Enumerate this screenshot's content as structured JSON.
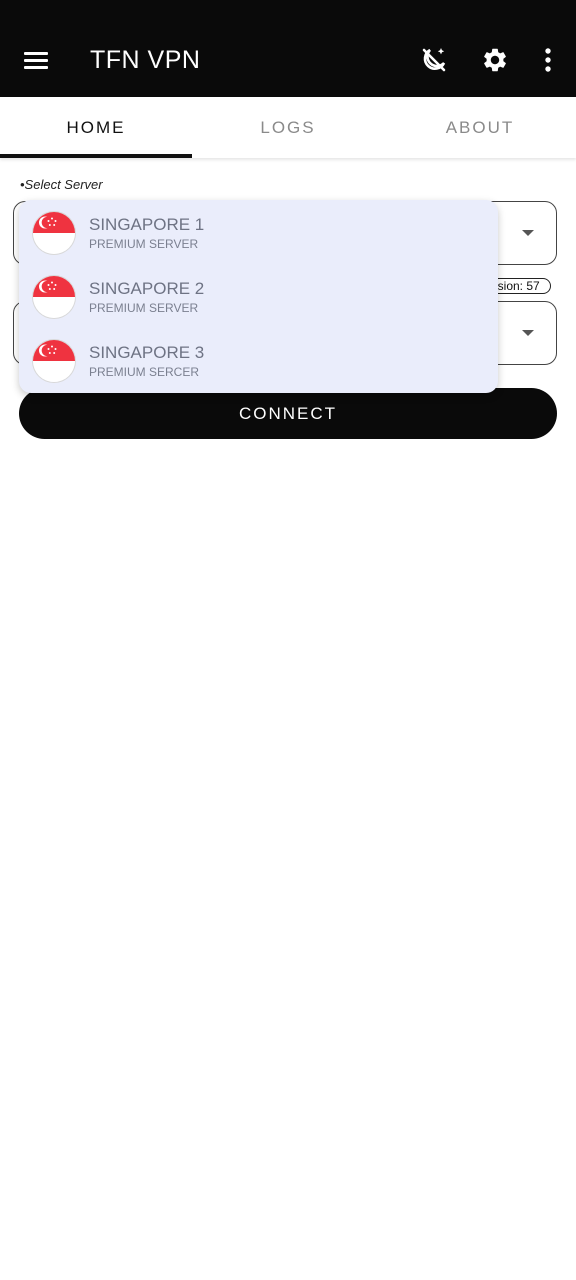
{
  "appbar": {
    "title": "TFN VPN",
    "menu_icon": "hamburger-menu-icon",
    "actions": [
      "night-mode-icon",
      "gear-icon",
      "more-vert-icon"
    ],
    "bg": "#0a0a0a"
  },
  "tabs": [
    {
      "label": "HOME",
      "active": true
    },
    {
      "label": "LOGS",
      "active": false
    },
    {
      "label": "ABOUT",
      "active": false
    }
  ],
  "select_label": "•Select Server",
  "version_text": "version: 57",
  "connect_label": "CONNECT",
  "dropdown": {
    "bg": "#eaedfb",
    "options": [
      {
        "title": "SINGAPORE 1",
        "subtitle": "PREMIUM SERVER",
        "flag": "singapore-flag-icon"
      },
      {
        "title": "SINGAPORE 2",
        "subtitle": "PREMIUM SERVER",
        "flag": "singapore-flag-icon"
      },
      {
        "title": "SINGAPORE 3",
        "subtitle": "PREMIUM SERCER",
        "flag": "singapore-flag-icon"
      }
    ]
  },
  "colors": {
    "flag_red": "#ef3340",
    "flag_white": "#ffffff",
    "accent": "#111111"
  }
}
